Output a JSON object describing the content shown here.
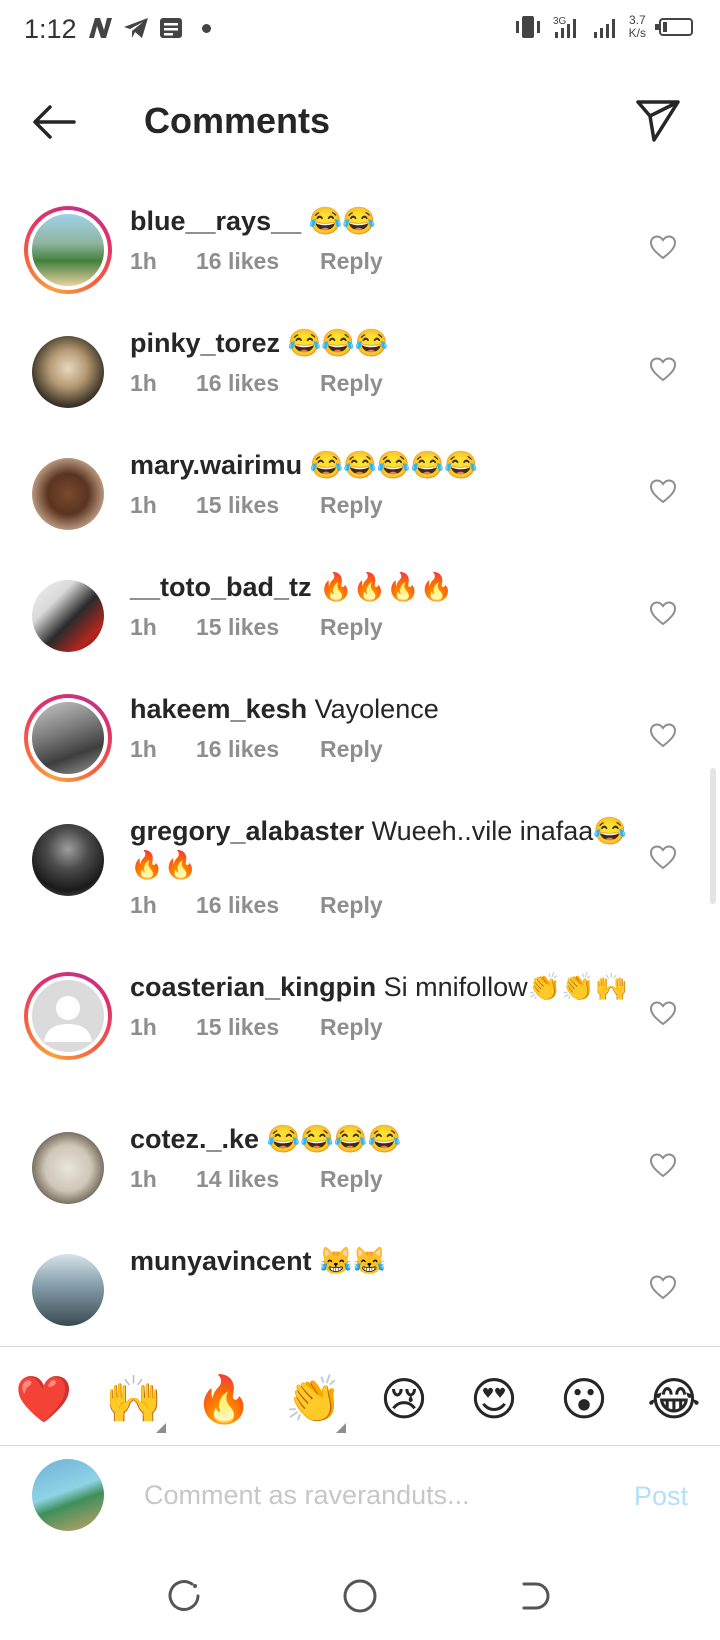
{
  "status_bar": {
    "time": "1:12",
    "speed_value": "3.7",
    "speed_unit": "K/s"
  },
  "header": {
    "title": "Comments"
  },
  "comments": [
    {
      "username": "blue__rays__",
      "text": "😂😂",
      "time": "1h",
      "likes": "16 likes",
      "reply": "Reply",
      "story_ring": true
    },
    {
      "username": "pinky_torez",
      "text": "😂😂😂",
      "time": "1h",
      "likes": "16 likes",
      "reply": "Reply",
      "story_ring": false
    },
    {
      "username": "mary.wairimu",
      "text": "😂😂😂😂😂",
      "time": "1h",
      "likes": "15 likes",
      "reply": "Reply",
      "story_ring": false
    },
    {
      "username": "__toto_bad_tz",
      "text": "🔥🔥🔥🔥",
      "time": "1h",
      "likes": "15 likes",
      "reply": "Reply",
      "story_ring": false
    },
    {
      "username": "hakeem_kesh",
      "text": "Vayolence",
      "time": "1h",
      "likes": "16 likes",
      "reply": "Reply",
      "story_ring": true
    },
    {
      "username": "gregory_alabaster",
      "text": "Wueeh..vile inafaa😂🔥🔥",
      "time": "1h",
      "likes": "16 likes",
      "reply": "Reply",
      "story_ring": false
    },
    {
      "username": "coasterian_kingpin",
      "text": "Si mnifollow👏👏🙌",
      "time": "1h",
      "likes": "15 likes",
      "reply": "Reply",
      "story_ring": true
    },
    {
      "username": "cotez._.ke",
      "text": "😂😂😂😂",
      "time": "1h",
      "likes": "14 likes",
      "reply": "Reply",
      "story_ring": false
    },
    {
      "username": "munyavincent",
      "text": "😹😹",
      "time": "",
      "likes": "",
      "reply": "",
      "story_ring": false
    }
  ],
  "reactions": [
    "❤️",
    "🙌",
    "🔥",
    "👏",
    "😢",
    "😍",
    "😮",
    "😂"
  ],
  "composer": {
    "placeholder": "Comment as raveranduts...",
    "post_label": "Post"
  },
  "colors": {
    "heart": "#ed4956",
    "muted_text": "#8e8e8e",
    "post_disabled": "#b2dffc"
  }
}
